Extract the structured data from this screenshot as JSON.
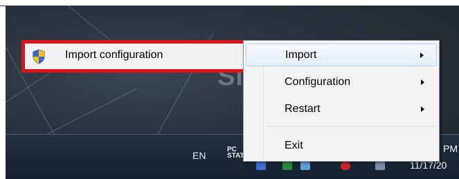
{
  "highlighted_item": {
    "label": "Import configuration",
    "icon": "uac-shield-icon",
    "highlight_color": "#e0141c"
  },
  "context_menu": {
    "items": [
      {
        "label": "Import",
        "has_submenu": true,
        "state": "hover"
      },
      {
        "label": "Configuration",
        "has_submenu": true
      },
      {
        "label": "Restart",
        "has_submenu": true
      },
      {
        "label": "Exit",
        "has_submenu": false
      }
    ]
  },
  "taskbar": {
    "language": "EN",
    "tray_app_label_line1": "PC",
    "tray_app_label_line2": "STAT",
    "clock_time_partial": "PM",
    "clock_date_partial": "11/17/20",
    "tray_icons": [
      "network-icon",
      "checkmark-icon",
      "drive-icon",
      "error-icon",
      "flag-icon"
    ]
  },
  "desktop": {
    "wallpaper_text_partial": "Si"
  }
}
